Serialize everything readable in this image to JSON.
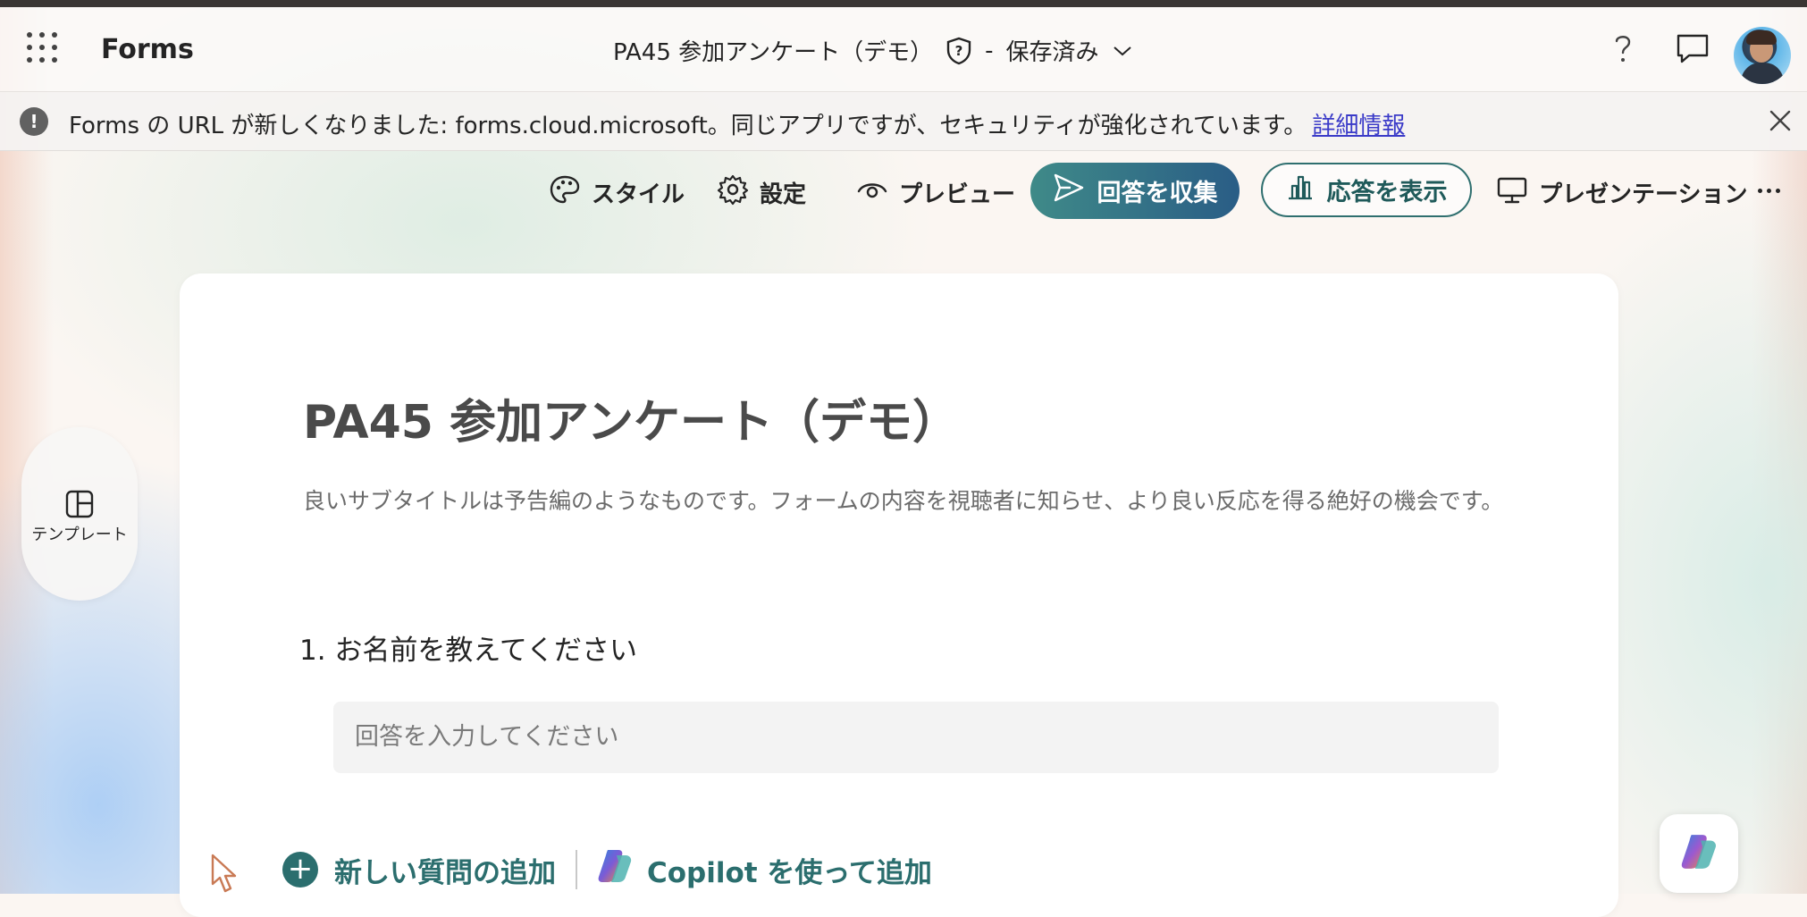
{
  "header": {
    "app_name": "Forms",
    "doc_title": "PA45 参加アンケート（デモ）",
    "separator": "-",
    "save_state": "保存済み"
  },
  "notice": {
    "text": "Forms の URL が新しくなりました: forms.cloud.microsoft。同じアプリですが、セキュリティが強化されています。",
    "link": "詳細情報"
  },
  "toolbar": {
    "style": "スタイル",
    "settings": "設定",
    "preview": "プレビュー",
    "collect": "回答を収集",
    "view_responses": "応答を表示",
    "present": "プレゼンテーション"
  },
  "sidebar": {
    "template_label": "テンプレート"
  },
  "form": {
    "title": "PA45 参加アンケート（デモ）",
    "subtitle": "良いサブタイトルは予告編のようなものです。フォームの内容を視聴者に知らせ、より良い反応を得る絶好の機会です。",
    "questions": [
      {
        "number": "1.",
        "text": "お名前を教えてください",
        "placeholder": "回答を入力してください"
      }
    ],
    "add_question": "新しい質問の追加",
    "add_with_copilot": "Copilot を使って追加"
  },
  "colors": {
    "accent_teal": "#2b6e6e",
    "collect_gradient_start": "#3f8a88",
    "collect_gradient_end": "#2a5d86",
    "link": "#3a3ac8"
  }
}
